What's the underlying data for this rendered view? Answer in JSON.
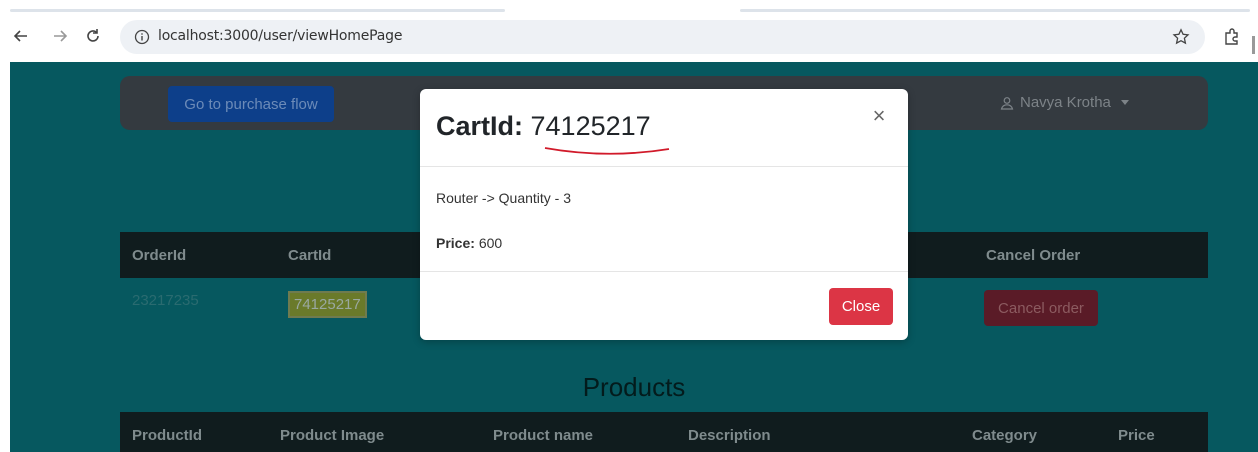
{
  "browser": {
    "url": "localhost:3000/user/viewHomePage",
    "icons": [
      "back-icon",
      "forward-icon",
      "reload-icon",
      "info-icon",
      "star-icon",
      "extensions-icon"
    ]
  },
  "navbar": {
    "purchase_button": "Go to purchase flow",
    "user_name": "Navya Krotha"
  },
  "orders_table": {
    "columns": [
      "OrderId",
      "CartId",
      "Cancel Order"
    ],
    "rows": [
      {
        "order_id": "23217235",
        "cart_id": "74125217",
        "action": "Cancel order"
      }
    ]
  },
  "products": {
    "title": "Products",
    "columns": [
      "ProductId",
      "Product Image",
      "Product name",
      "Description",
      "Category",
      "Price"
    ]
  },
  "modal": {
    "title_label": "CartId:",
    "title_value": "74125217",
    "item_line": "Router -> Quantity - 3",
    "price_label": "Price:",
    "price_value": "600",
    "close_button": "Close",
    "close_icon": "×"
  },
  "colors": {
    "page_bg": "#06585f",
    "navbar_bg": "#343a40",
    "close_button": "#dc3545",
    "annotation_red": "#d11a2a"
  }
}
